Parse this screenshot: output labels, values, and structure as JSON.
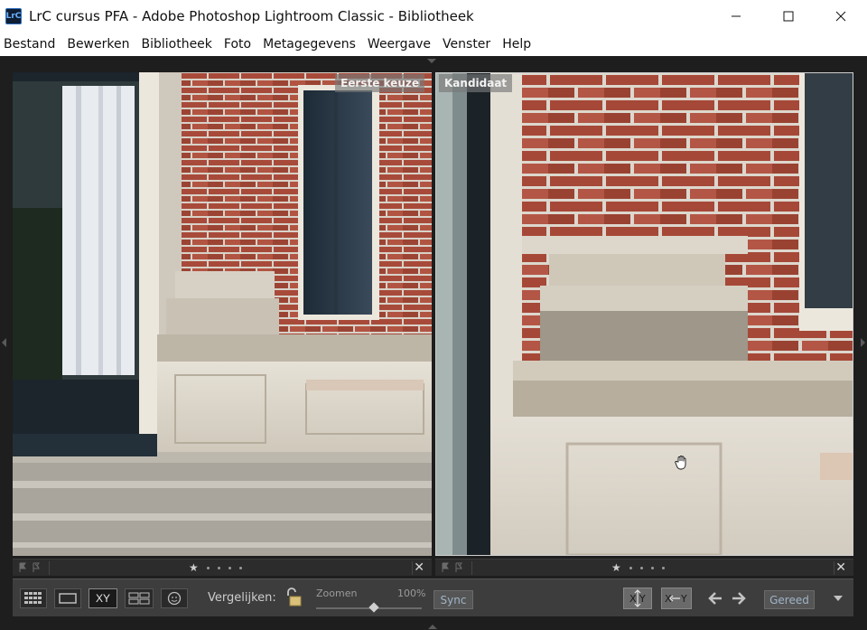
{
  "window": {
    "logo_text": "LrC",
    "title": "LrC cursus PFA - Adobe Photoshop Lightroom Classic - Bibliotheek"
  },
  "menu": [
    "Bestand",
    "Bewerken",
    "Bibliotheek",
    "Foto",
    "Metagegevens",
    "Weergave",
    "Venster",
    "Help"
  ],
  "compare": {
    "left_label": "Eerste keuze",
    "right_label": "Kandidaat"
  },
  "toolbar": {
    "compare_label": "Vergelijken:",
    "zoom_label": "Zoomen",
    "zoom_value": "100%",
    "zoom_fraction": 0.55,
    "sync_label": "Sync",
    "swap_label": "X Y",
    "done_label": "Gereed",
    "view_xy_label": "XY"
  },
  "colors": {
    "accent_sync": "#9fb4c8",
    "panel_bg": "#1e1e1e"
  }
}
